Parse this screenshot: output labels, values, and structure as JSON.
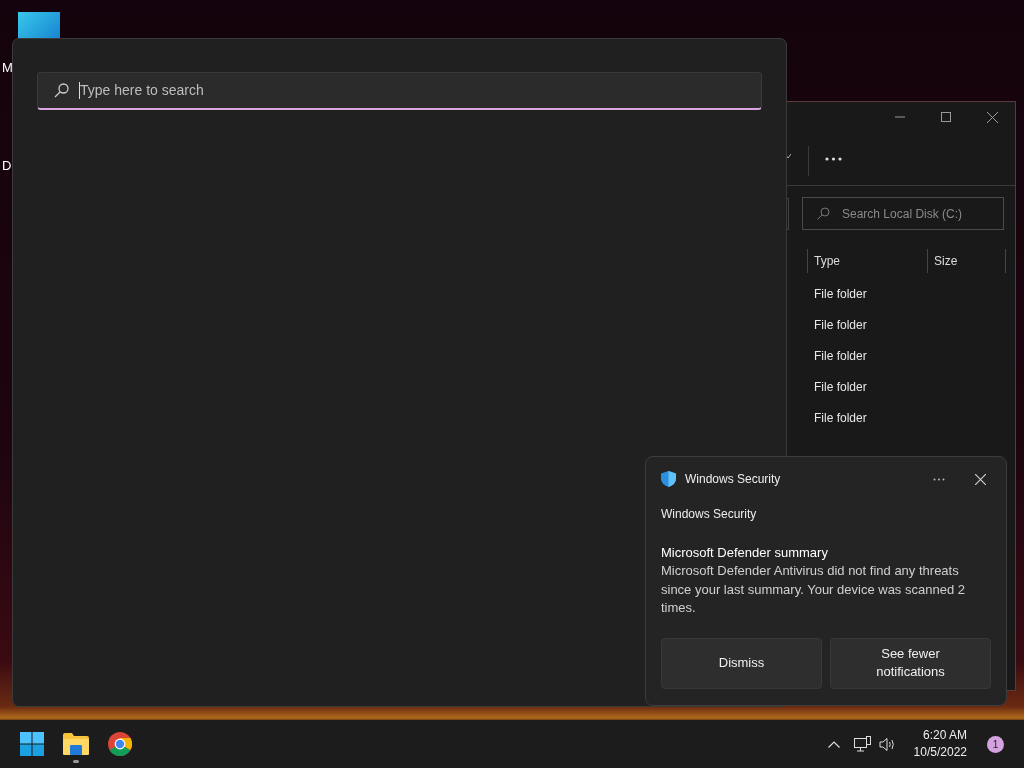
{
  "desktop": {
    "icons": [
      {
        "label": "M"
      },
      {
        "label": "D"
      }
    ]
  },
  "search_panel": {
    "placeholder": "Type here to search"
  },
  "explorer": {
    "search_placeholder": "Search Local Disk (C:)",
    "columns": [
      "Type",
      "Size"
    ],
    "rows": [
      {
        "type": "File folder"
      },
      {
        "type": "File folder"
      },
      {
        "type": "File folder"
      },
      {
        "type": "File folder"
      },
      {
        "type": "File folder"
      }
    ]
  },
  "toast": {
    "app": "Windows Security",
    "source": "Windows Security",
    "title": "Microsoft Defender summary",
    "body": "Microsoft Defender Antivirus did not find any threats since your last summary. Your device was scanned 2 times.",
    "buttons": [
      "Dismiss",
      "See fewer notifications"
    ]
  },
  "taskbar": {
    "apps": [
      {
        "kind": "start",
        "running": false
      },
      {
        "kind": "explorer",
        "running": true
      },
      {
        "kind": "chrome",
        "running": false
      }
    ],
    "time": "6:20 AM",
    "date": "10/5/2022",
    "badge": "1"
  }
}
